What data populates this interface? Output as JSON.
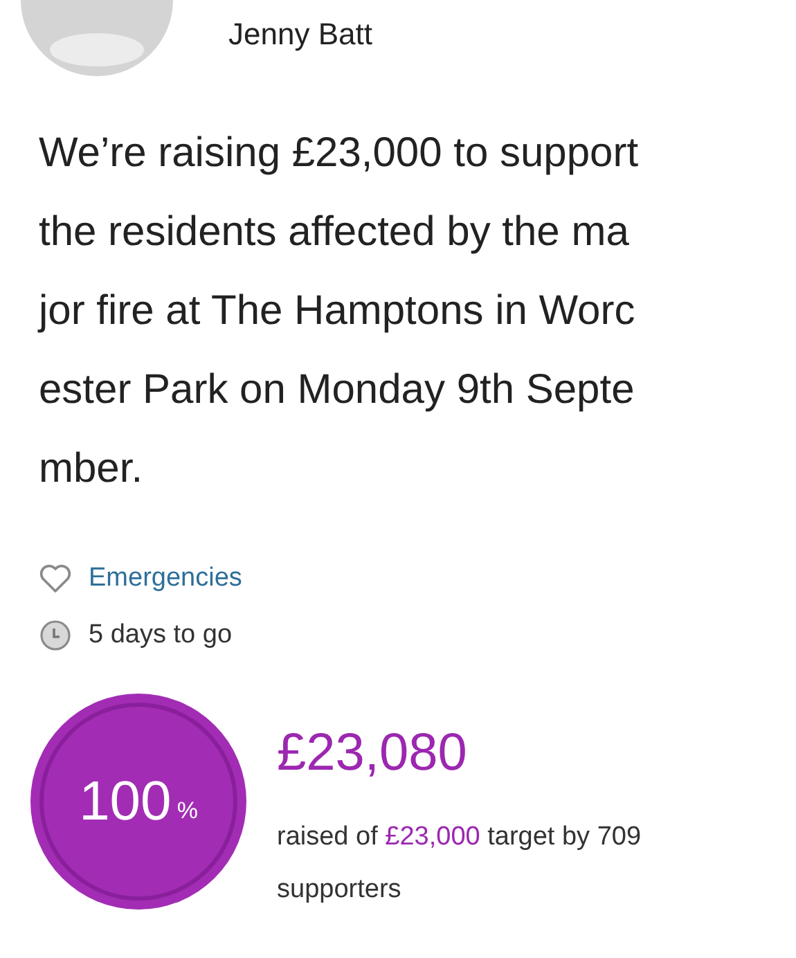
{
  "organiser": {
    "name": "Jenny Batt"
  },
  "description_lines": [
    "We’re raising £23,000 to support",
    "the residents affected by the ma",
    "jor fire at The Hamptons in Worc",
    "ester Park on Monday 9th Septe",
    "mber."
  ],
  "category": "Emergencies",
  "time_left": "5 days to go",
  "progress": {
    "percent": "100",
    "unit": "%",
    "level": 1
  },
  "raised": "£23,080",
  "summary": {
    "before": "raised of ",
    "target": "£23,000",
    "after": " target by 709 supporters"
  }
}
